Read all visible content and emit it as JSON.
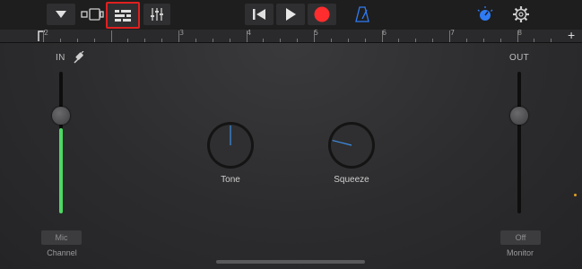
{
  "toolbar": {
    "buttons": [
      {
        "name": "menu-dropdown-button",
        "icon": "triangle-down-icon"
      },
      {
        "name": "tracks-view-button",
        "icon": "tracks-view-icon"
      },
      {
        "name": "smart-controls-button",
        "icon": "smart-controls-icon",
        "selected": true,
        "highlight_color": "#e02020"
      },
      {
        "name": "mixer-button",
        "icon": "sliders-icon"
      },
      {
        "name": "go-to-start-button",
        "icon": "skip-back-icon"
      },
      {
        "name": "play-button",
        "icon": "play-icon"
      },
      {
        "name": "record-button",
        "icon": "record-icon",
        "color": "#ff2d2d"
      },
      {
        "name": "metronome-button",
        "icon": "metronome-icon",
        "color": "#2f7bf5"
      },
      {
        "name": "master-volume-button",
        "icon": "master-volume-icon",
        "color": "#2f7bf5"
      },
      {
        "name": "settings-button",
        "icon": "gear-icon"
      }
    ]
  },
  "ruler": {
    "numbers": [
      "2",
      "3",
      "4",
      "5",
      "6",
      "7",
      "8"
    ],
    "add_label": "+"
  },
  "input": {
    "label": "IN",
    "icon": "input-cable-icon",
    "level": 0.6,
    "level_color": "#4cd964",
    "button_label": "Mic",
    "caption": "Channel"
  },
  "output": {
    "label": "OUT",
    "button_label": "Off",
    "caption": "Monitor"
  },
  "knobs": [
    {
      "label": "Tone",
      "indicator_color": "#3d8fe8",
      "value": 0.5
    },
    {
      "label": "Squeeze",
      "indicator_color": "#3d8fe8",
      "value": 0.22
    }
  ],
  "accent": "#3d8fe8"
}
